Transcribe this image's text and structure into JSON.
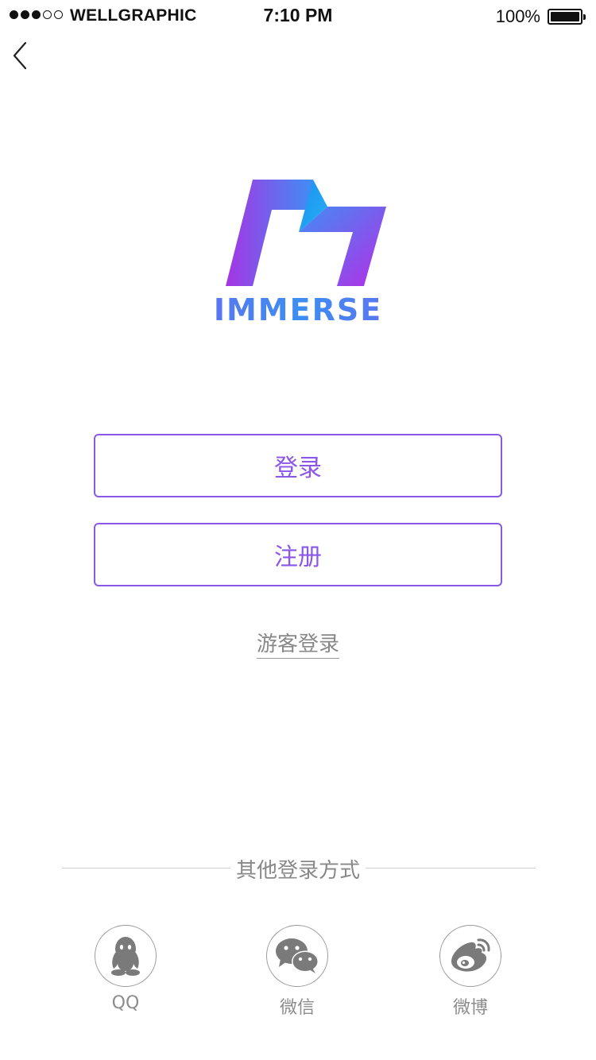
{
  "status_bar": {
    "carrier": "WELLGRAPHIC",
    "time": "7:10 PM",
    "battery": "100%",
    "signal_dots_filled": 3,
    "signal_dots_total": 5
  },
  "nav": {
    "back_icon": "chevron-left-icon"
  },
  "brand": {
    "name": "IMMERSE",
    "logo_icon": "immerse-logo-icon",
    "gradient_colors": [
      "#a13ee6",
      "#3c8ef3"
    ]
  },
  "actions": {
    "login_label": "登录",
    "register_label": "注册",
    "guest_label": "游客登录"
  },
  "other_login": {
    "title": "其他登录方式",
    "providers": [
      {
        "label": "QQ",
        "icon": "qq-icon"
      },
      {
        "label": "微信",
        "icon": "wechat-icon"
      },
      {
        "label": "微博",
        "icon": "weibo-icon"
      }
    ]
  },
  "colors": {
    "accent": "#8a57e8",
    "muted_text": "#888888",
    "icon_gray": "#7a7a7a"
  }
}
